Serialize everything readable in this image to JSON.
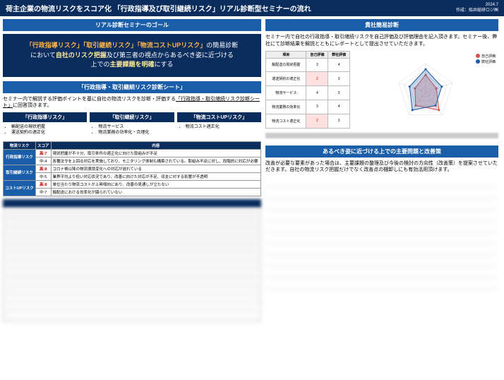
{
  "header": {
    "title": "荷主企業の物流リスクをスコア化 「行政指導及び取引継続リスク」リアル診断型セミナーの流れ",
    "date": "2024.7",
    "author": "作成：船井総研ロジ㈱"
  },
  "goal": {
    "bar": "リアル診断セミナーのゴール",
    "line1a": "「行政指導リスク」「取引継続リスク」「物流コストUPリスク」",
    "line1b": "の簡易診断",
    "line2a": "において",
    "line2b": "自社のリスク把握",
    "line2c": "及び第三者の視点からあるべき姿に近づける",
    "line3a": "上での",
    "line3b": "主要課題を明確",
    "line3c": "にする"
  },
  "sheet": {
    "bar": "「行政指導・取引継続リスク診断シート」",
    "desc_a": "セミナー内で解説する評価ポイントを基に自社の物流リスクを診断・評価する",
    "desc_b": "「行政指導・取引継続リスク診断シート」",
    "desc_c": "に回答頂きます。"
  },
  "risks": [
    {
      "head": "「行政指導リスク」",
      "items": [
        "輸配送の現状把握",
        "運送契約の適正化"
      ]
    },
    {
      "head": "「取引継続リスク」",
      "items": [
        "物流サービス",
        "物流業務の効率化・合理化"
      ]
    },
    {
      "head": "「物流コストUPリスク」",
      "items": [
        "物流コスト適正化"
      ]
    }
  ],
  "score_table": {
    "headers": [
      "物流リスク",
      "スコア",
      "内容"
    ],
    "rows": [
      {
        "cat": "行政指導リスク",
        "score": "高:7",
        "content": "現状把握が不十分、取引条件の適正化に向けた取組みが不足",
        "high": true
      },
      {
        "cat": "",
        "score": "中:4",
        "content": "各種法令を上回る対応を実施しており、モニタリング体制も構築されている。取組み不足に対し、段階的に対応が必要",
        "high": false
      },
      {
        "cat": "取引継続リスク",
        "score": "高:8",
        "content": "コロナ禍以降の物流環境変化への対応が遅れている",
        "high": true
      },
      {
        "cat": "",
        "score": "中:5",
        "content": "業界平均より低い対応状況であり、改善に向けた対応が不足、収支に対する影響が不透明",
        "high": false
      },
      {
        "cat": "コストUPリスク",
        "score": "高:8",
        "content": "単位当たり物流コストが上昇傾向にあり、改善の見通しが立たない",
        "high": true
      },
      {
        "cat": "",
        "score": "中:7",
        "content": "輸配送における効率化が図られていない",
        "high": false
      }
    ]
  },
  "diag": {
    "bar": "貴社簡易診断",
    "desc": "セミナー内で自社の行政指導・取引継続リスクを自己評価及び評価理由を記入頂きます。セミナー後、弊社にて診断結果を解説とともにレポートとして提出させていただきます。"
  },
  "chart_data": {
    "type": "radar",
    "categories": [
      "輸配送の現状把握",
      "運送契約の適正化",
      "物流サービス",
      "物流業務の効率化",
      "物流コスト適正化"
    ],
    "series": [
      {
        "name": "自己評価",
        "values": [
          3,
          2,
          4,
          3,
          2
        ],
        "color": "#d9534f"
      },
      {
        "name": "弊社評価",
        "values": [
          4,
          3,
          3,
          4,
          3
        ],
        "color": "#1a5da8"
      }
    ],
    "max": 5,
    "mini_table": {
      "headers": [
        "項目",
        "自己評価",
        "弊社評価"
      ],
      "rows": [
        [
          "輸配送の現状把握",
          "3",
          "4"
        ],
        [
          "運送契約の適正化",
          "2",
          "3"
        ],
        [
          "物流サービス",
          "4",
          "3"
        ],
        [
          "物流業務の効率化",
          "3",
          "4"
        ],
        [
          "物流コスト適正化",
          "2",
          "3"
        ]
      ]
    }
  },
  "improve": {
    "bar": "あるべき姿に近づける上での主要問題と改善策",
    "desc": "改善が必要な要素があった場合は、主要課題の整理及び今後の検討の方向性（改善策）を提案させていただきます。自社の物流リスク把握だけでなく改善点の棚卸しにも有効活用頂けます。"
  }
}
